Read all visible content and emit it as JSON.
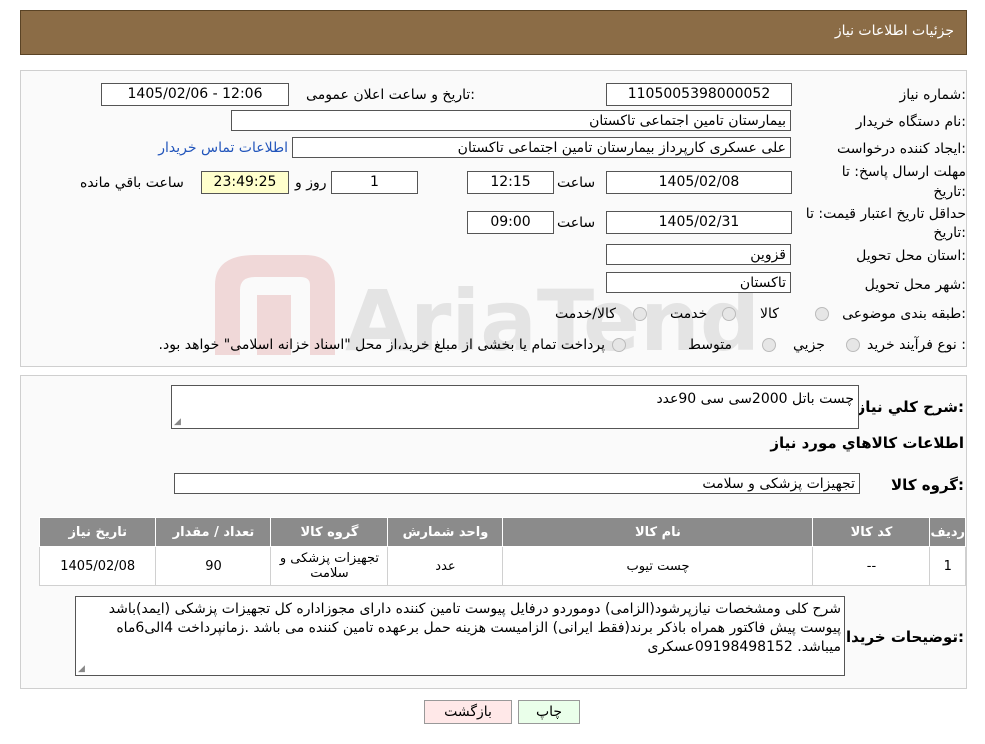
{
  "header": {
    "title": "جزئیات اطلاعات نیاز"
  },
  "form": {
    "need_number_label": "شماره نیاز:",
    "need_number": "1105005398000052",
    "announce_label": "تاریخ و ساعت اعلان عمومی:",
    "announce_value": "1405/02/06 - 12:06",
    "buyer_org_label": "نام دستگاه خریدار:",
    "buyer_org": "بیمارستان تامین اجتماعی تاکستان",
    "creator_label": "ایجاد کننده درخواست:",
    "creator": "علی عسکری کارپرداز بیمارستان تامین اجتماعی تاکستان",
    "contact_link": "اطلاعات تماس خریدار",
    "deadline_label_1": "مهلت ارسال پاسخ: تا",
    "deadline_label_2": "تاریخ:",
    "deadline_date": "1405/02/08",
    "time_label": "ساعت",
    "deadline_time": "12:15",
    "days_value": "1",
    "days_label": "روز و",
    "remaining_time": "23:49:25",
    "remaining_label": "ساعت باقي مانده",
    "validity_label_1": "حداقل تاریخ اعتبار قیمت: تا",
    "validity_label_2": "تاریخ:",
    "validity_date": "1405/02/31",
    "validity_time": "09:00",
    "province_label": "استان محل تحویل:",
    "province": "قزوین",
    "city_label": "شهر محل تحویل:",
    "city": "تاکستان",
    "category_label": "طبقه بندی موضوعی:",
    "category_options": [
      "کالا",
      "خدمت",
      "کالا/خدمت"
    ],
    "process_label": "نوع فرآیند خرید :",
    "process_options": [
      "جزیي",
      "متوسط"
    ],
    "payment_note": "پرداخت تمام یا بخشی از مبلغ خرید،از محل \"اسناد خزانه اسلامی\" خواهد بود."
  },
  "summary": {
    "label": "شرح کلي نیاز:",
    "value": "چست باتل 2000سی سی 90عدد",
    "goods_info_title": "اطلاعات کالاهاي مورد نیاز",
    "group_label": "گروه کالا:",
    "group_value": "تجهیزات پزشکی و سلامت"
  },
  "table": {
    "headers": [
      "ردیف",
      "کد کالا",
      "نام کالا",
      "واحد شمارش",
      "گروه کالا",
      "تعداد / مقدار",
      "تاریخ نیاز"
    ],
    "rows": [
      [
        "1",
        "--",
        "چست تیوب",
        "عدد",
        "تجهیزات پزشکی و سلامت",
        "90",
        "1405/02/08"
      ]
    ]
  },
  "buyer_notes": {
    "label": "توضیحات خریدار:",
    "value": "شرح کلی ومشخصات نیازپرشود(الزامی) دوموردو درفایل پیوست تامین کننده دارای مجوزاداره کل تجهیزات پزشکی (ایمد)باشد پیوست پیش فاکتور همراه باذکر برند(فقط ایرانی) الزامیست هزینه حمل برعهده تامین کننده می باشد .زمانپرداخت 4الی6ماه میباشد. 09198498152عسکری"
  },
  "buttons": {
    "print": "چاپ",
    "back": "بازگشت"
  },
  "watermark": {
    "text": "AriaTender.neT"
  },
  "colors": {
    "header_bg": "#8b6c46",
    "table_header_bg": "#8b8b8b",
    "print_bg": "#eaffea",
    "back_bg": "#ffe8e8",
    "timer_bg": "#ffffcc",
    "link": "#2255bb"
  }
}
